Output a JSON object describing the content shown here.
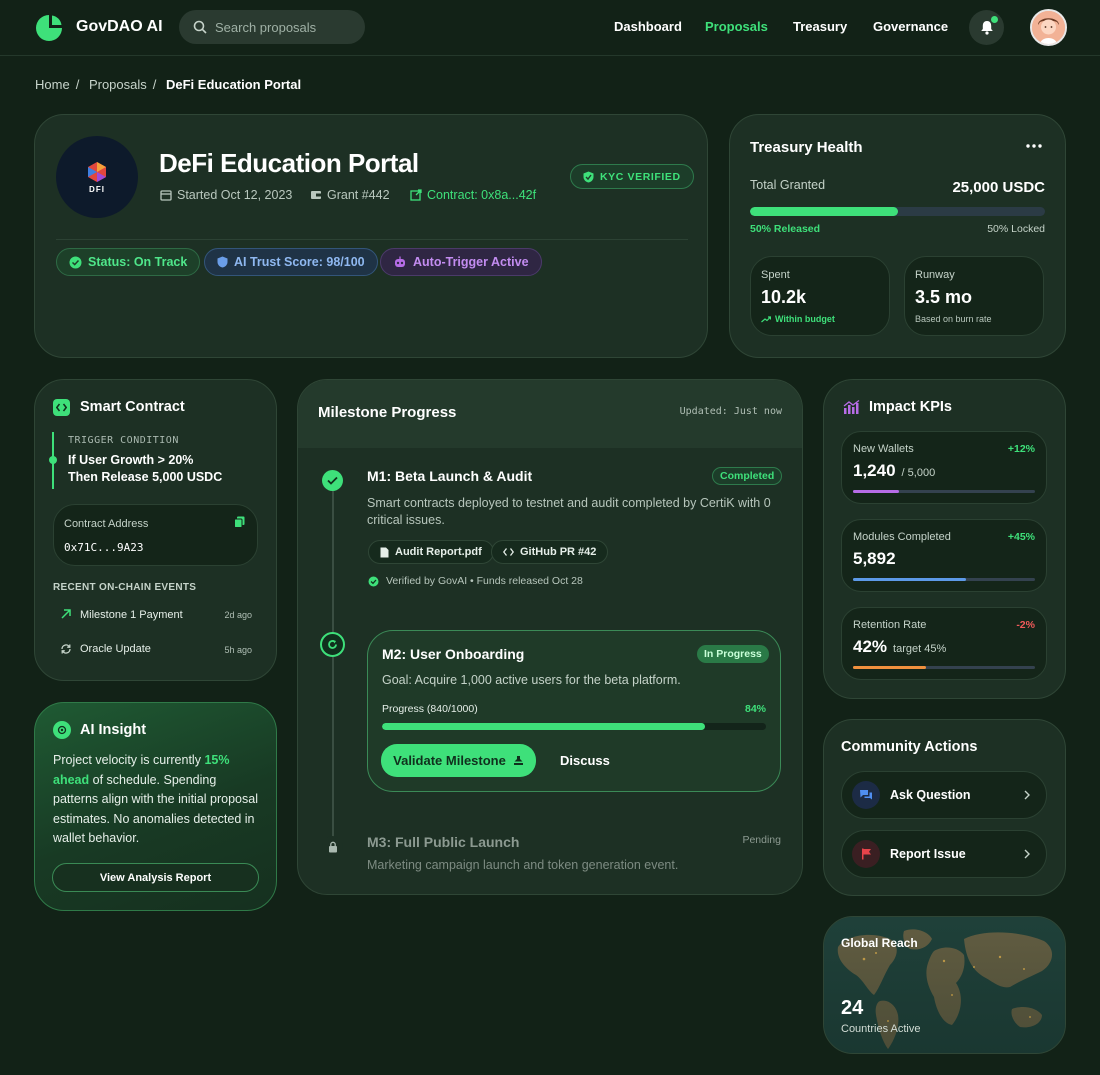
{
  "header": {
    "brand": "GovDAO AI",
    "search_placeholder": "Search proposals",
    "nav": [
      "Dashboard",
      "Proposals",
      "Treasury",
      "Governance"
    ],
    "active_nav": "Proposals",
    "notification_dot": true
  },
  "breadcrumb": [
    "Home",
    "Proposals",
    "DeFi Education Portal"
  ],
  "hero": {
    "logo_text": "DFI",
    "title": "DeFi Education Portal",
    "started": "Started Oct 12, 2023",
    "grant": "Grant #442",
    "contract": "Contract: 0x8a...42f",
    "kyc": "KYC VERIFIED",
    "status": "Status: On Track",
    "trust": "AI Trust Score: 98/100",
    "trigger": "Auto-Trigger Active"
  },
  "treasury": {
    "title": "Treasury Health",
    "total_label": "Total Granted",
    "total_value": "25,000 USDC",
    "released_pct": 0.5,
    "released_label": "50% Released",
    "locked_label": "50% Locked",
    "spent_label": "Spent",
    "spent_value": "10.2k",
    "spent_note": "Within budget",
    "runway_label": "Runway",
    "runway_value": "3.5 mo",
    "runway_note": "Based on burn rate"
  },
  "smart_contract": {
    "title": "Smart Contract",
    "trigger_label": "TRIGGER CONDITION",
    "trigger_line1": "If User Growth > 20%",
    "trigger_line2": "Then Release 5,000 USDC",
    "address_label": "Contract Address",
    "address_value": "0x71C...9A23",
    "events_label": "RECENT ON-CHAIN EVENTS",
    "events": [
      {
        "name": "Milestone 1 Payment",
        "time": "2d ago"
      },
      {
        "name": "Oracle Update",
        "time": "5h ago"
      }
    ]
  },
  "insight": {
    "title": "AI Insight",
    "text_before": "Project velocity is currently ",
    "highlight": "15% ahead",
    "text_after": " of schedule. Spending patterns align with the initial proposal estimates. No anomalies detected in wallet behavior.",
    "button": "View Analysis Report"
  },
  "milestones": {
    "title": "Milestone Progress",
    "updated": "Updated: Just now",
    "m1": {
      "title": "M1: Beta Launch & Audit",
      "status": "Completed",
      "desc1": "Smart contracts deployed to testnet and audit completed by CertiK with 0",
      "desc2": "critical issues.",
      "file1": "Audit Report.pdf",
      "file2": "GitHub PR #42",
      "verified": "Verified by GovAI • Funds released Oct 28"
    },
    "m2": {
      "title": "M2: User Onboarding",
      "status": "In Progress",
      "goal": "Goal: Acquire 1,000 active users for the beta platform.",
      "progress_label": "Progress (840/1000)",
      "progress_pct": "84%",
      "progress_value": 0.84,
      "validate": "Validate Milestone",
      "discuss": "Discuss"
    },
    "m3": {
      "title": "M3: Full Public Launch",
      "status": "Pending",
      "desc": "Marketing campaign launch and token generation event."
    }
  },
  "kpis": {
    "title": "Impact KPIs",
    "items": [
      {
        "label": "New Wallets",
        "change": "+12%",
        "value": "1,240",
        "sub": "/ 5,000",
        "fill": 0.25,
        "color": "#b66ce6",
        "change_color": "#3ee07a"
      },
      {
        "label": "Modules Completed",
        "change": "+45%",
        "value": "5,892",
        "sub": "",
        "fill": 0.62,
        "color": "#5d9ae8",
        "change_color": "#3ee07a"
      },
      {
        "label": "Retention Rate",
        "change": "-2%",
        "value": "42%",
        "sub": "target 45%",
        "fill": 0.4,
        "color": "#f0913e",
        "change_color": "#f05a5a"
      }
    ]
  },
  "community": {
    "title": "Community Actions",
    "ask": "Ask Question",
    "report": "Report Issue"
  },
  "global": {
    "title": "Global Reach",
    "count": "24",
    "label": "Countries Active"
  }
}
